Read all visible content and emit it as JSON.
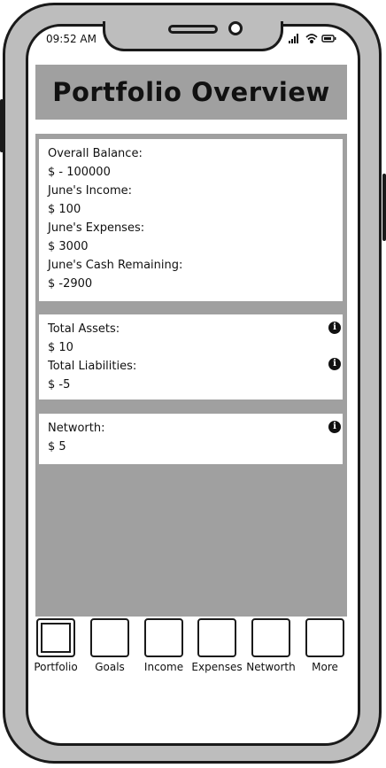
{
  "status_bar": {
    "time": "09:52 AM",
    "icons": [
      "cellular-signal-icon",
      "wifi-icon",
      "battery-icon"
    ]
  },
  "header": {
    "title": "Portfolio Overview"
  },
  "summary_card": {
    "overall_balance_label": "Overall Balance:",
    "overall_balance_value": "$ - 100000",
    "income_label": "June's Income:",
    "income_value": "$ 100",
    "expenses_label": "June's Expenses:",
    "expenses_value": "$ 3000",
    "cash_remaining_label": "June's Cash Remaining:",
    "cash_remaining_value": "$ -2900"
  },
  "assets_card": {
    "assets_label": "Total Assets:",
    "assets_value": "$ 10",
    "liabilities_label": "Total Liabilities:",
    "liabilities_value": "$ -5"
  },
  "networth_card": {
    "networth_label": "Networth:",
    "networth_value": "$ 5"
  },
  "info_icon_glyph": "i",
  "tabs": [
    {
      "label": "Portfolio",
      "active": true
    },
    {
      "label": "Goals",
      "active": false
    },
    {
      "label": "Income",
      "active": false
    },
    {
      "label": "Expenses",
      "active": false
    },
    {
      "label": "Networth",
      "active": false
    },
    {
      "label": "More",
      "active": false
    }
  ],
  "colors": {
    "panel_gray": "#a0a0a0",
    "frame": "#1a1a1a",
    "bezel": "#bdbdbd"
  }
}
